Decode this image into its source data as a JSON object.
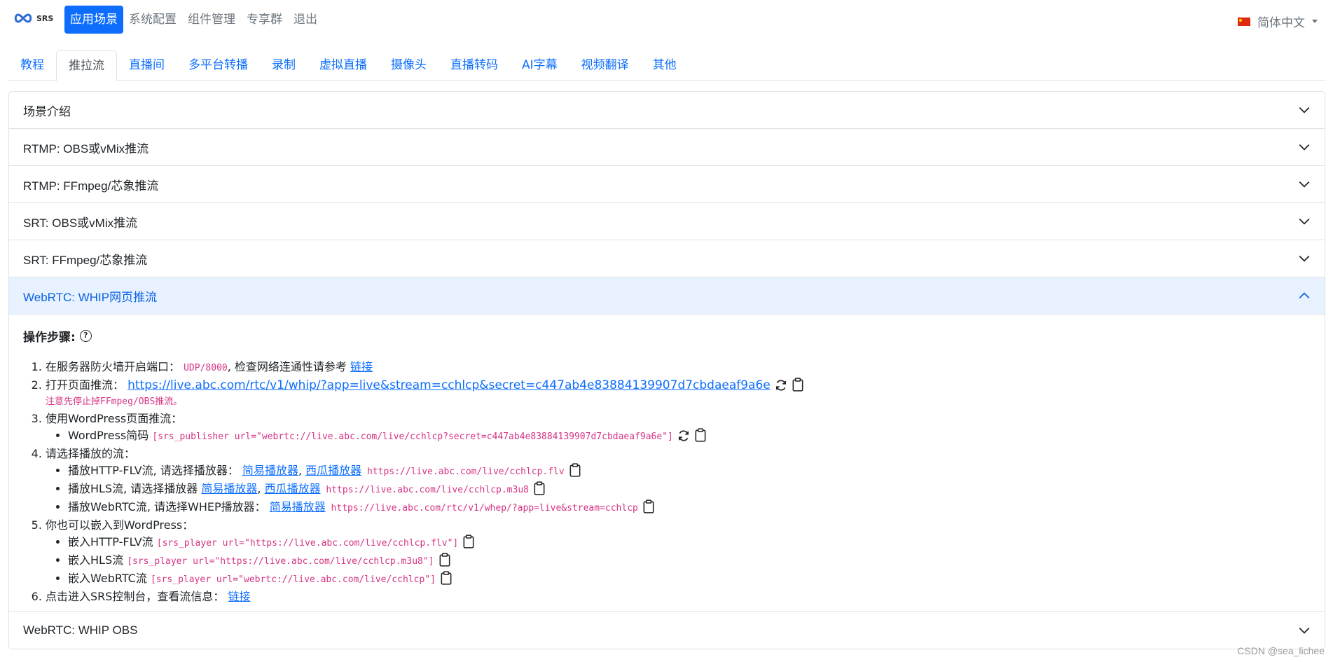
{
  "navbar": {
    "logo_text": "SRS",
    "items": [
      {
        "label": "应用场景",
        "active": true
      },
      {
        "label": "系统配置",
        "active": false
      },
      {
        "label": "组件管理",
        "active": false
      },
      {
        "label": "专享群",
        "active": false
      },
      {
        "label": "退出",
        "active": false
      }
    ],
    "language": "简体中文"
  },
  "tabs": [
    {
      "label": "教程",
      "active": false
    },
    {
      "label": "推拉流",
      "active": true
    },
    {
      "label": "直播间",
      "active": false
    },
    {
      "label": "多平台转播",
      "active": false
    },
    {
      "label": "录制",
      "active": false
    },
    {
      "label": "虚拟直播",
      "active": false
    },
    {
      "label": "摄像头",
      "active": false
    },
    {
      "label": "直播转码",
      "active": false
    },
    {
      "label": "AI字幕",
      "active": false
    },
    {
      "label": "视频翻译",
      "active": false
    },
    {
      "label": "其他",
      "active": false
    }
  ],
  "accordion": {
    "sections": [
      {
        "title": "场景介绍"
      },
      {
        "title": "RTMP: OBS或vMix推流"
      },
      {
        "title": "RTMP: FFmpeg/芯象推流"
      },
      {
        "title": "SRT: OBS或vMix推流"
      },
      {
        "title": "SRT: FFmpeg/芯象推流"
      },
      {
        "title": "WebRTC: WHIP网页推流"
      }
    ],
    "last_section": {
      "title": "WebRTC: WHIP OBS"
    }
  },
  "body": {
    "steps_title": "操作步骤:",
    "step1": {
      "text": "在服务器防火墙开启端口：",
      "port": "UDP/8000",
      "suffix": ", 检查网络连通性请参考 ",
      "link": "链接"
    },
    "step2": {
      "text": "打开页面推流： ",
      "url": "https://live.abc.com/rtc/v1/whip/?app=live&stream=cchlcp&secret=c447ab4e83884139907d7cbdaeaf9a6e",
      "note": "注意先停止掉FFmpeg/OBS推流。"
    },
    "step3": {
      "text": "使用WordPress页面推流：",
      "sub_label": "WordPress简码 ",
      "shortcode": "[srs_publisher url=\"webrtc://live.abc.com/live/cchlcp?secret=c447ab4e83884139907d7cbdaeaf9a6e\"]"
    },
    "step4": {
      "text": "请选择播放的流：",
      "flv": {
        "label": "播放HTTP-FLV流, 请选择播放器： ",
        "link1": "简易播放器",
        "sep": ", ",
        "link2": "西瓜播放器",
        "url": " https://live.abc.com/live/cchlcp.flv"
      },
      "hls": {
        "label": "播放HLS流, 请选择播放器 ",
        "link1": "简易播放器",
        "sep": ", ",
        "link2": "西瓜播放器",
        "url": " https://live.abc.com/live/cchlcp.m3u8"
      },
      "rtc": {
        "label": "播放WebRTC流, 请选择WHEP播放器： ",
        "link1": "简易播放器",
        "url": " https://live.abc.com/rtc/v1/whep/?app=live&stream=cchlcp"
      }
    },
    "step5": {
      "text": "你也可以嵌入到WordPress：",
      "flv": {
        "label": "嵌入HTTP-FLV流 ",
        "code": "[srs_player url=\"https://live.abc.com/live/cchlcp.flv\"]"
      },
      "hls": {
        "label": "嵌入HLS流 ",
        "code": "[srs_player url=\"https://live.abc.com/live/cchlcp.m3u8\"]"
      },
      "rtc": {
        "label": "嵌入WebRTC流 ",
        "code": "[srs_player url=\"webrtc://live.abc.com/live/cchlcp\"]"
      }
    },
    "step6": {
      "text": "点击进入SRS控制台，查看流信息： ",
      "link": "链接"
    }
  },
  "watermark": "CSDN @sea_lichee",
  "colors": {
    "primary": "#0d6efd",
    "code": "#d63384",
    "open_header_bg": "#e7f1ff"
  }
}
